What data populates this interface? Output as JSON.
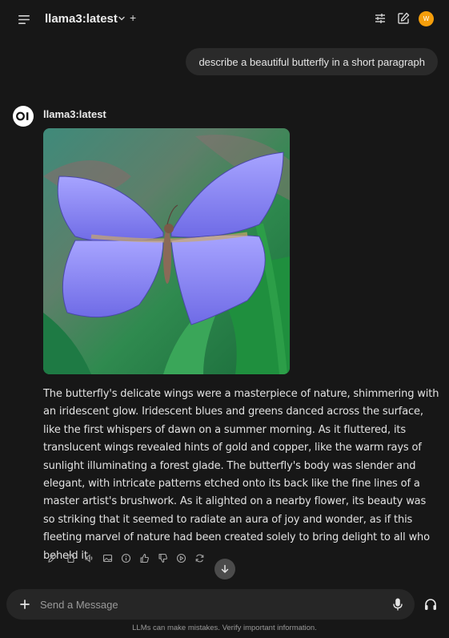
{
  "header": {
    "model_name": "llama3:latest",
    "add_symbol": "+",
    "user_initial": "W",
    "user_avatar_color": "#f59e0b"
  },
  "user_message": "describe a beautiful butterfly in a short paragraph",
  "assistant": {
    "name": "llama3:latest",
    "reply": "The butterfly's delicate wings were a masterpiece of nature, shimmering with an iridescent glow. Iridescent blues and greens danced across the surface, like the first whispers of dawn on a summer morning. As it fluttered, its translucent wings revealed hints of gold and copper, like the warm rays of sunlight illuminating a forest glade. The butterfly's body was slender and elegant, with intricate patterns etched onto its back like the fine lines of a master artist's brushwork. As it alighted on a nearby flower, its beauty was so striking that it seemed to radiate an aura of joy and wonder, as if this fleeting marvel of nature had been created solely to bring delight to all who beheld it.",
    "actions": [
      "edit-icon",
      "copy-icon",
      "read-aloud-icon",
      "image-icon",
      "info-icon",
      "thumbs-up-icon",
      "thumbs-down-icon",
      "continue-icon",
      "regenerate-icon"
    ]
  },
  "composer": {
    "placeholder": "Send a Message"
  },
  "footer": {
    "disclaimer": "LLMs can make mistakes. Verify important information."
  },
  "colors": {
    "background": "#171717",
    "bubble": "#2a2a2a",
    "composer": "#262626",
    "butterfly_wing": "#8f8cf2"
  }
}
